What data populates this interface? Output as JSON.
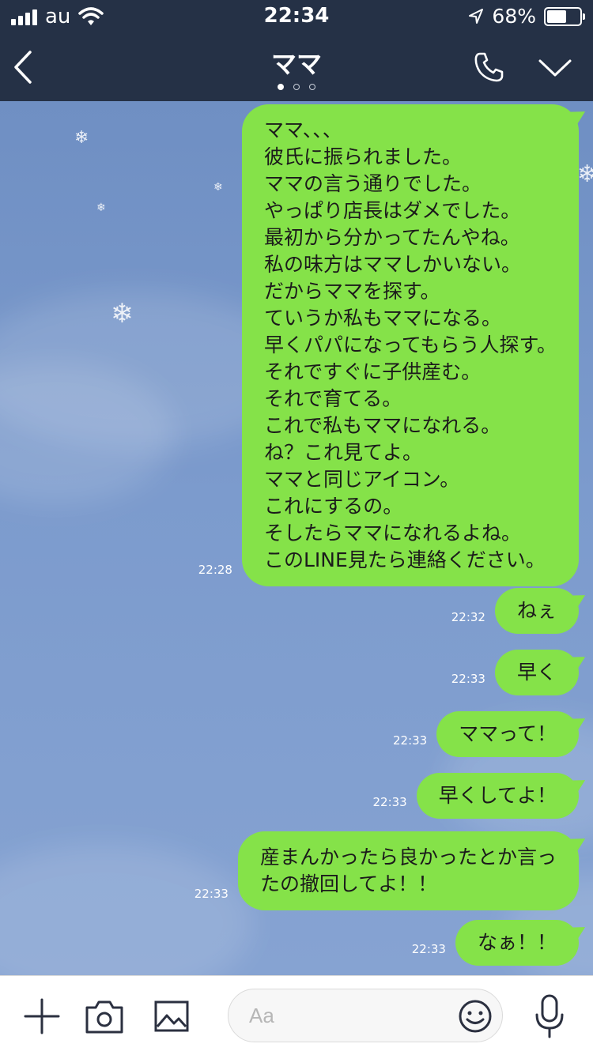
{
  "status_bar": {
    "carrier": "au",
    "time": "22:34",
    "battery_percent": "68%",
    "battery_level": 0.68
  },
  "header": {
    "title": "ママ",
    "page_indicator": {
      "count": 3,
      "active_index": 0
    }
  },
  "messages": [
    {
      "text": "ママ、、、\n彼氏に振られました。\nママの言う通りでした。\nやっぱり店長はダメでした。\n最初から分かってたんやね。\n私の味方はママしかいない。\nだからママを探す。\nていうか私もママになる。\n早くパパになってもらう人探す。\nそれですぐに子供産む。\nそれで育てる。\nこれで私もママになれる。\nね？これ見てよ。\nママと同じアイコン。\nこれにするの。\nそしたらママになれるよね。\nこのLINE見たら連絡ください。",
      "time": "22:28"
    },
    {
      "text": "ねぇ",
      "time": "22:32"
    },
    {
      "text": "早く",
      "time": "22:33"
    },
    {
      "text": "ママって！",
      "time": "22:33"
    },
    {
      "text": "早くしてよ！",
      "time": "22:33"
    },
    {
      "text": "産まんかったら良かったとか言っ\nたの撤回してよ！！",
      "time": "22:33"
    },
    {
      "text": "なぁ！！",
      "time": "22:33"
    }
  ],
  "input_bar": {
    "placeholder": "Aa"
  },
  "colors": {
    "bar_background": "#253146",
    "bubble": "#85e249",
    "chat_background": "#7b9ac9"
  },
  "icons": [
    "back-icon",
    "phone-icon",
    "chevron-down-icon",
    "plus-icon",
    "camera-icon",
    "image-icon",
    "emoji-icon",
    "microphone-icon"
  ]
}
